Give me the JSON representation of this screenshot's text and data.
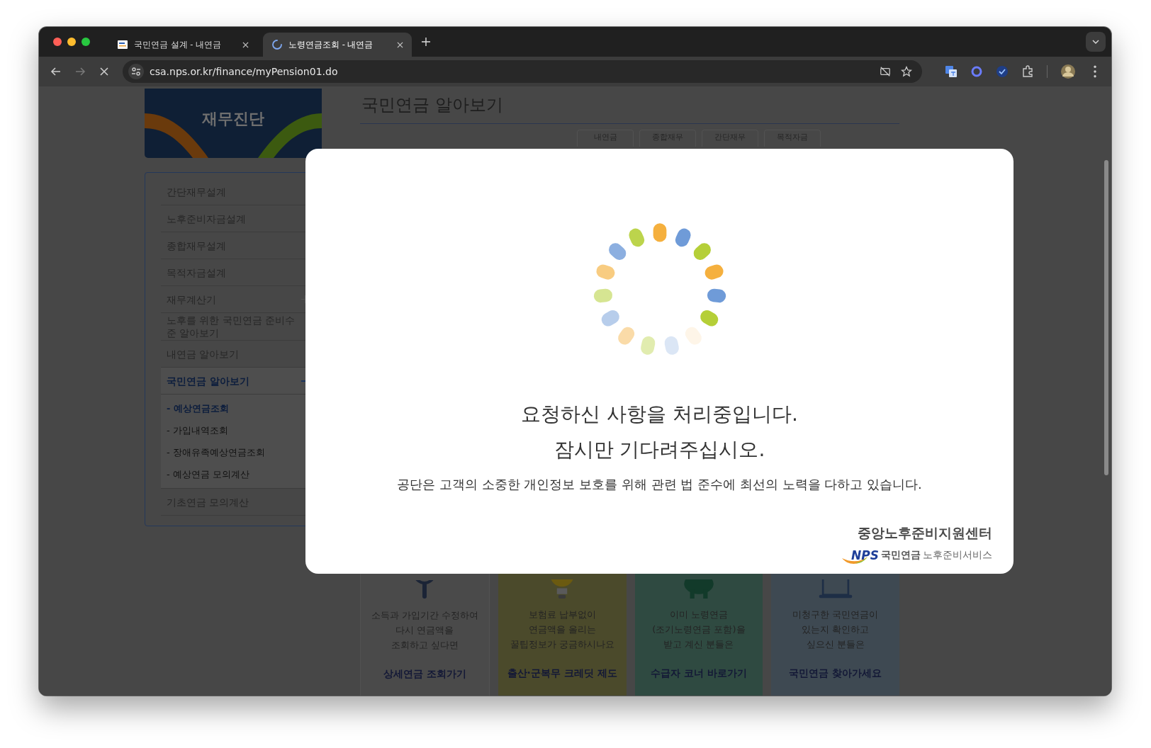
{
  "browser": {
    "tabs": [
      {
        "title": "국민연금 설계 - 내연금",
        "selected": false,
        "loading": false
      },
      {
        "title": "노령연금조회 - 내연금",
        "selected": true,
        "loading": true
      }
    ],
    "url": "csa.nps.or.kr/finance/myPension01.do"
  },
  "sidebar": {
    "banner": "재무진단",
    "items": [
      {
        "label": "간단재무설계",
        "selected": false
      },
      {
        "label": "노후준비자금설계",
        "selected": false
      },
      {
        "label": "종합재무설계",
        "selected": false
      },
      {
        "label": "목적자금설계",
        "selected": false
      },
      {
        "label": "재무계산기",
        "selected": false,
        "expanded": false
      },
      {
        "label": "노후를 위한 국민연금 준비수준 알아보기",
        "selected": false
      },
      {
        "label": "내연금 알아보기",
        "selected": false
      },
      {
        "label": "국민연금 알아보기",
        "selected": true,
        "expanded": true,
        "children": [
          {
            "label": "- 예상연금조회",
            "selected": true
          },
          {
            "label": "- 가입내역조회",
            "selected": false
          },
          {
            "label": "- 장애유족예상연금조회",
            "selected": false
          },
          {
            "label": "- 예상연금 모의계산",
            "selected": false
          }
        ]
      },
      {
        "label": "기초연금 모의계산",
        "selected": false
      }
    ]
  },
  "main": {
    "title": "국민연금 알아보기",
    "subtabs": [
      "내연금",
      "종합재무",
      "간단재무",
      "목적자금"
    ],
    "cards": [
      {
        "kind": "search",
        "lines": [
          "소득과 가입기간 수정하여",
          "다시 연금액을",
          "조회하고 싶다면"
        ],
        "link": "상세연금 조회가기"
      },
      {
        "kind": "bulb",
        "lines": [
          "보험료 납부없이",
          "연금액을 올리는",
          "꿀팁정보가 궁금하시나요"
        ],
        "link": "출산·군복무 크레딧 제도"
      },
      {
        "kind": "piggy",
        "lines": [
          "이미 노령연금",
          "(조기노령연금 포함)을",
          "받고 계신 분들은"
        ],
        "link": "수급자 코너 바로가기"
      },
      {
        "kind": "laptop",
        "lines": [
          "미청구한 국민연금이",
          "있는지 확인하고",
          "싶으신 분들은"
        ],
        "link": "국민연금 찾아가세요"
      }
    ]
  },
  "modal": {
    "message": "요청하신 사항을 처리중입니다.",
    "wait": "잠시만 기다려주십시오.",
    "notice": "공단은 고객의 소중한 개인정보 보호를 위해 관련 법 준수에 최선의 노력을 다하고 있습니다.",
    "logo": {
      "center": "중앙노후준비지원센터",
      "brand": "NPS",
      "org": "국민연금",
      "service": "노후준비서비스"
    }
  }
}
